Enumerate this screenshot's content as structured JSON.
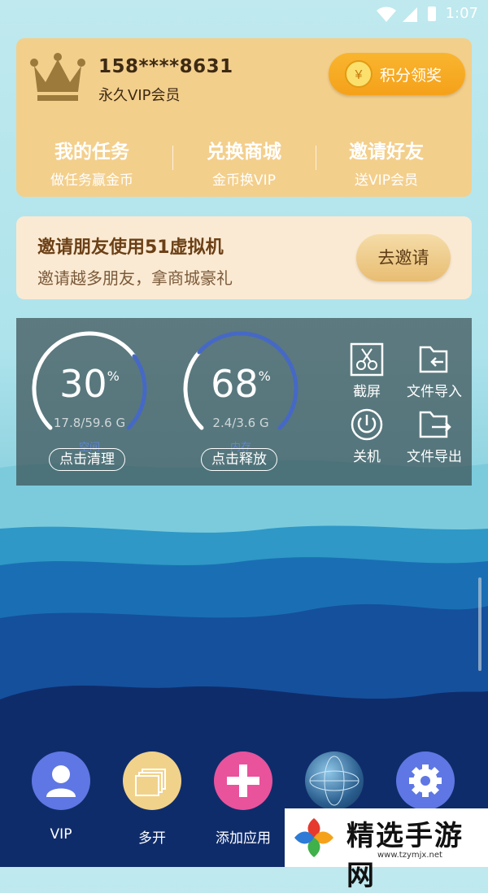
{
  "status_bar": {
    "time": "1:07"
  },
  "vip_card": {
    "phone": "158****8631",
    "level": "永久VIP会员",
    "reward_button": "积分领奖",
    "tasks": [
      {
        "title": "我的任务",
        "subtitle": "做任务赢金币"
      },
      {
        "title": "兑换商城",
        "subtitle": "金币换VIP"
      },
      {
        "title": "邀请好友",
        "subtitle": "送VIP会员"
      }
    ]
  },
  "invite": {
    "title": "邀请朋友使用51虚拟机",
    "subtitle": "邀请越多朋友，拿商城豪礼",
    "button": "去邀请"
  },
  "storage": {
    "space": {
      "percent": "30",
      "percent_value": 30,
      "pct_sign": "%",
      "detail": "17.8/59.6 G",
      "kind": "空间",
      "button": "点击清理"
    },
    "memory": {
      "percent": "68",
      "percent_value": 68,
      "pct_sign": "%",
      "detail": "2.4/3.6 G",
      "kind": "内存",
      "button": "点击释放"
    }
  },
  "tools": {
    "screenshot": "截屏",
    "import": "文件导入",
    "shutdown": "关机",
    "export": "文件导出"
  },
  "dock": [
    {
      "label": "VIP",
      "color": "#5f77e4",
      "icon": "user-icon"
    },
    {
      "label": "多开",
      "color": "#f1d28a",
      "icon": "windows-icon"
    },
    {
      "label": "添加应用",
      "color": "#e9539c",
      "icon": "plus-icon"
    },
    {
      "label": "",
      "color": "#2b5f8f",
      "icon": "globe-icon"
    },
    {
      "label": "",
      "color": "#5f77e4",
      "icon": "gear-icon"
    }
  ],
  "watermark": {
    "text": "精选手游网",
    "url": "www.tzymjx.net"
  }
}
